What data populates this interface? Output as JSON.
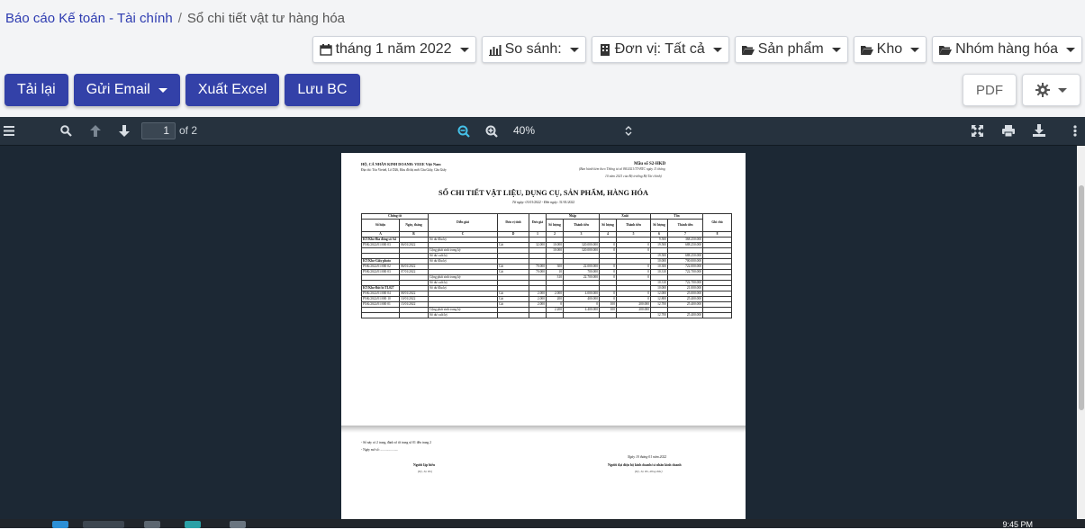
{
  "breadcrumb": {
    "parent": "Báo cáo Kế toán - Tài chính",
    "sep": "/",
    "current": "Sổ chi tiết vật tư hàng hóa"
  },
  "filters": {
    "period": "tháng 1 năm 2022",
    "compare": "So sánh:",
    "unit": "Đơn vị: Tất cả",
    "product": "Sản phẩm",
    "warehouse": "Kho",
    "group": "Nhóm hàng hóa"
  },
  "actions": {
    "reload": "Tải lại",
    "email": "Gửi Email",
    "excel": "Xuất Excel",
    "save": "Lưu BC",
    "pdf": "PDF"
  },
  "viewer": {
    "page": "1",
    "of": "of 2",
    "zoom": "40%"
  },
  "report": {
    "org1": "HỘ, CÁ NHÂN KINH DOANH: VEEE Việt Nam",
    "org2": "Địa chỉ: Tòa Viettel, Lô D26, Khu đô thị mới Cầu Giấy, Cầu Giấy",
    "form": "Mẫu số S2-HKD",
    "formnote1": "(Ban hành kèm theo Thông tư số 88/2021/TT-BTC ngày 11 tháng",
    "formnote2": "10 năm 2021 của Bộ trưởng Bộ Tài chính)",
    "title": "SỔ CHI TIẾT VẬT LIỆU, DỤNG CỤ, SẢN PHẨM, HÀNG HÓA",
    "daterange": "Từ ngày: 01/01/2022 - Đến ngày: 31/01/2022",
    "h": {
      "voucher": "Chứng từ",
      "desc": "Diễn giải",
      "unit": "Đơn vị tính",
      "price": "Đơn giá",
      "in": "Nhập",
      "out": "Xuất",
      "stock": "Tồn",
      "note": "Ghi chú",
      "no": "Số hiệu",
      "date": "Ngày, tháng",
      "qty": "Số lượng",
      "amt": "Thành tiền"
    },
    "codes": [
      "A",
      "B",
      "C",
      "D",
      "1",
      "2",
      "3",
      "4",
      "5",
      "6",
      "7",
      "8"
    ],
    "rows": [
      {
        "t": "grp",
        "a": "KT/Kho-Bìa đóng số A4",
        "c": "Số dư đầu kỳ",
        "q3": "9.500",
        "m3": "368.250.000"
      },
      {
        "t": "row",
        "a": "PNK/2022/01/000 03",
        "b": "06/01/2022",
        "d": "Cái",
        "p": "32.000",
        "q1": "10.000",
        "m1": "320.000.000",
        "q2": "0",
        "m2": "0",
        "q3": "19.500",
        "m3": "688.250.000"
      },
      {
        "t": "sum",
        "c": "Cộng phát sinh trong kỳ",
        "q1": "10.000",
        "m1": "320.000.000",
        "q2": "0",
        "m2": "0"
      },
      {
        "t": "sum",
        "c": "Số dư cuối kỳ",
        "q3": "19.500",
        "m3": "688.250.000"
      },
      {
        "t": "grp",
        "a": "KT/Kho-Giấy photo",
        "c": "Số dư đầu kỳ",
        "q3": "10.000",
        "m3": "700.000.000"
      },
      {
        "t": "row",
        "a": "PNK/2022/01/000 02",
        "b": "06/01/2022",
        "d": "Cái",
        "p": "70.000",
        "q1": "300",
        "m1": "22.000.000",
        "q2": "0",
        "m2": "0",
        "q3": "10.300",
        "m3": "722.000.000"
      },
      {
        "t": "row",
        "a": "PNK/2022/01/000 03",
        "b": "07/01/2022",
        "d": "Cái",
        "p": "70.000",
        "q1": "10",
        "m1": "700.000",
        "q2": "0",
        "m2": "0",
        "q3": "10.310",
        "m3": "722.700.000"
      },
      {
        "t": "sum",
        "c": "Cộng phát sinh trong kỳ",
        "q1": "310",
        "m1": "22.700.000",
        "q2": "0",
        "m2": "0"
      },
      {
        "t": "sum",
        "c": "Số dư cuối kỳ",
        "q3": "10.310",
        "m3": "722.700.000"
      },
      {
        "t": "grp",
        "a": "KT/Kho-Bút bi TL027",
        "c": "Số dư đầu kỳ",
        "q3": "10.000",
        "m3": "21.000.000"
      },
      {
        "t": "row",
        "a": "PNK/2022/01/000 04",
        "b": "08/01/2022",
        "d": "Cái",
        "p": "2.000",
        "q1": "2.000",
        "m1": "4.000.000",
        "q2": "0",
        "m2": "0",
        "q3": "12.000",
        "m3": "25.000.000"
      },
      {
        "t": "row",
        "a": "PNK/2022/01/000 10",
        "b": "10/01/2022",
        "d": "Cái",
        "p": "2.000",
        "q1": "200",
        "m1": "400.000",
        "q2": "0",
        "m2": "0",
        "q3": "12.800",
        "m3": "25.400.000"
      },
      {
        "t": "row",
        "a": "PXK/2022/01/000 01",
        "b": "15/01/2022",
        "d": "Cái",
        "p": "2.000",
        "q1": "0",
        "m1": "0",
        "q2": "100",
        "m2": "200.000",
        "q3": "12.700",
        "m3": "25.400.000"
      },
      {
        "t": "sum",
        "c": "Cộng phát sinh trong kỳ",
        "q1": "2.200",
        "m1": "4.400.000",
        "q2": "100",
        "m2": "200.000"
      },
      {
        "t": "sum",
        "c": "Số dư cuối kỳ",
        "q3": "12.700",
        "m3": "25.400.000"
      }
    ],
    "foot1": "- Sổ này có 2 trang, đánh số từ trang số 01 đến trang 2",
    "foot2": "- Ngày mở sổ: ......................",
    "signdate": "Ngày 10 tháng 01 năm 2022",
    "signer1": "Người lập biểu",
    "signer1n": "(Ký, họ tên)",
    "signer2": "Người đại diện hộ kinh doanh/cá nhân kinh doanh",
    "signer2n": "(Ký, họ tên, đóng dấu)"
  },
  "taskbar": {
    "clock": "9:45 PM"
  }
}
